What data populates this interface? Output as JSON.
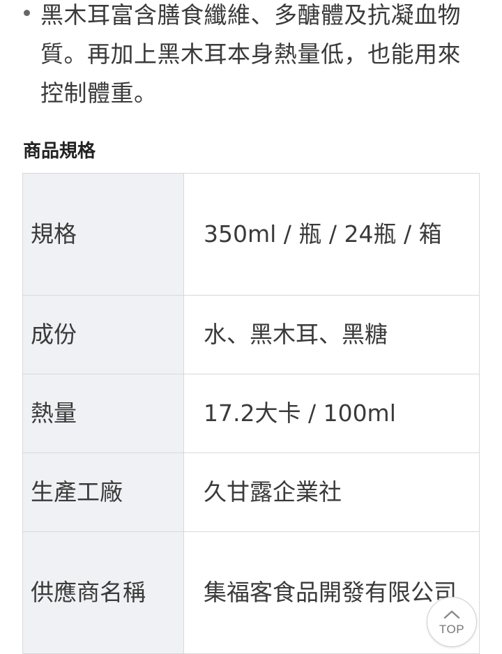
{
  "description": {
    "bullet_text": "黑木耳富含膳食纖維、多醣體及抗凝血物質。再加上黑木耳本身熱量低，也能用來控制體重。"
  },
  "specs": {
    "title": "商品規格",
    "rows": [
      {
        "label": "規格",
        "value": "350ml / 瓶 / 24瓶 / 箱"
      },
      {
        "label": "成份",
        "value": "水、黑木耳、黑糖"
      },
      {
        "label": "熱量",
        "value": "17.2大卡 / 100ml"
      },
      {
        "label": "生產工廠",
        "value": "久甘露企業社"
      },
      {
        "label": "供應商名稱",
        "value": "集福客食品開發有限公司"
      }
    ]
  },
  "top_button": {
    "label": "TOP",
    "icon": "chevron-up-icon"
  }
}
